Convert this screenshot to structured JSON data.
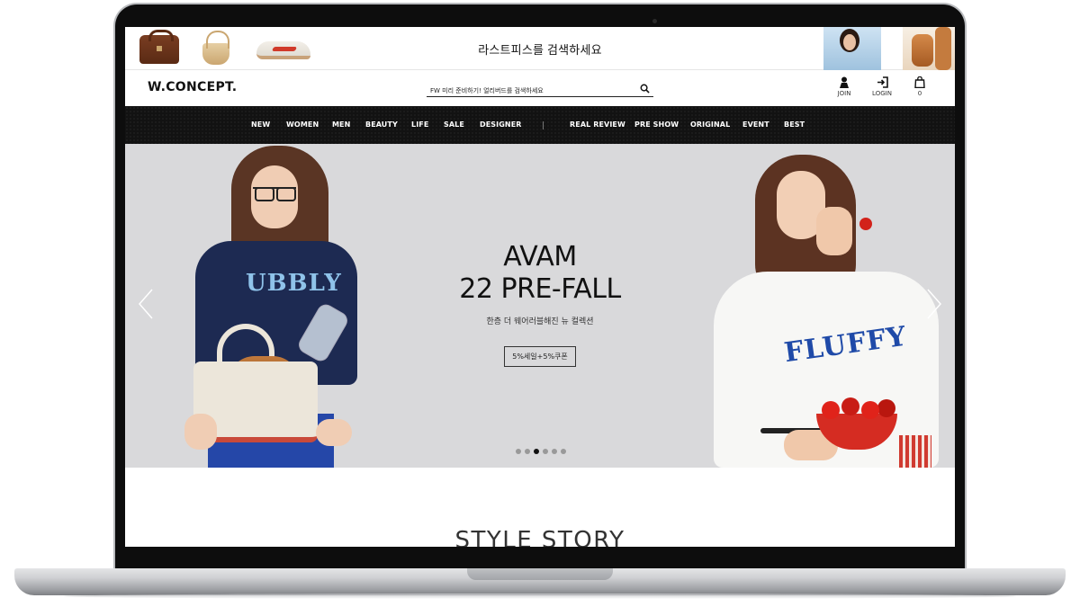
{
  "promo": {
    "text": "라스트피스를 검색하세요"
  },
  "header": {
    "logo": "W.CONCEPT.",
    "search_placeholder": "FW 미리 준비하기! 얼리버드를 검색하세요",
    "join_label": "JOIN",
    "login_label": "LOGIN",
    "cart_count": "0"
  },
  "nav": {
    "left": [
      "NEW",
      "WOMEN",
      "MEN",
      "BEAUTY",
      "LIFE",
      "SALE",
      "DESIGNER"
    ],
    "right": [
      "REAL REVIEW",
      "PRE SHOW",
      "ORIGINAL",
      "EVENT",
      "BEST"
    ]
  },
  "hero": {
    "title_line1": "AVAM",
    "title_line2": "22 PRE-FALL",
    "subtitle": "한층 더 웨어러블해진 뉴 컬렉션",
    "button": "5%세일+5%쿠폰",
    "slide_count": 6,
    "active_slide": 3,
    "left_shirt_text": "UBBLY",
    "right_shirt_text": "FLUFFY"
  },
  "section": {
    "title": "STYLE STORY"
  },
  "colors": {
    "nav_bg": "#121212",
    "hero_bg": "#d9d9db",
    "text": "#111111"
  }
}
